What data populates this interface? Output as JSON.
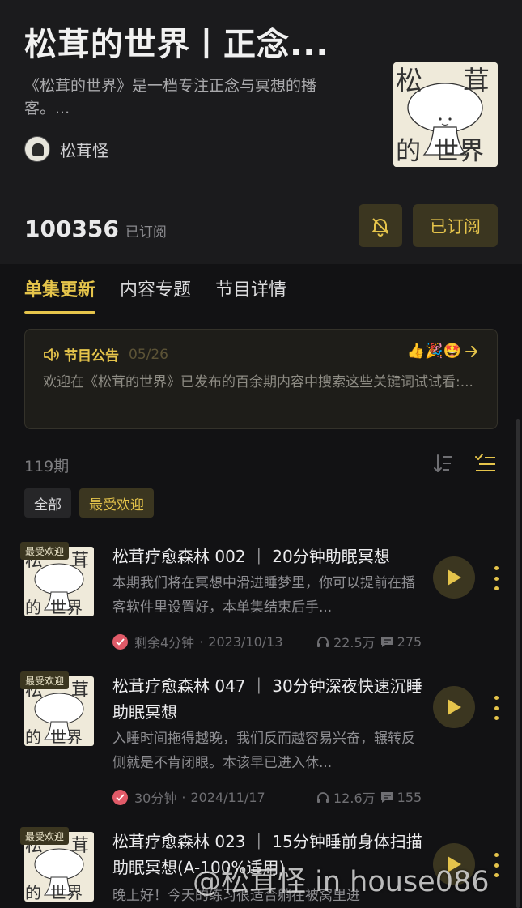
{
  "podcast": {
    "title": "松茸的世界丨正念...",
    "description": "《松茸的世界》是一档专注正念与冥想的播客。...",
    "author": "松茸怪",
    "cover_text": [
      "松",
      "茸",
      "的",
      "世界"
    ],
    "subscriber_count": "100356",
    "subscriber_label": "已订阅",
    "subscribe_button": "已订阅"
  },
  "tabs": [
    {
      "label": "单集更新",
      "active": true
    },
    {
      "label": "内容专题",
      "active": false
    },
    {
      "label": "节目详情",
      "active": false
    }
  ],
  "notice": {
    "title": "节目公告",
    "date": "05/26",
    "emojis": "👍🎉🤩",
    "text": "欢迎在《松茸的世界》已发布的百余期内容中搜索这些关键词试试看:..."
  },
  "episode_count": "119期",
  "filters": [
    "全部",
    "最受欢迎"
  ],
  "episodes": [
    {
      "badge": "最受欢迎",
      "title": "松茸疗愈森林 002 ｜ 20分钟助眠冥想",
      "summary": "本期我们将在冥想中滑进睡梦里，你可以提前在播客软件里设置好，本单集结束后手...",
      "progress": "剩余4分钟",
      "date": "2023/10/13",
      "plays": "22.5万",
      "comments": "275"
    },
    {
      "badge": "最受欢迎",
      "title": "松茸疗愈森林 047 ｜ 30分钟深夜快速沉睡助眠冥想",
      "summary": "入睡时间拖得越晚，我们反而越容易兴奋，辗转反侧就是不肯闭眼。本该早已进入休...",
      "progress": "30分钟",
      "date": "2024/11/17",
      "plays": "12.6万",
      "comments": "155"
    },
    {
      "badge": "最受欢迎",
      "title": "松茸疗愈森林 023 ｜ 15分钟睡前身体扫描助眠冥想(A-100%适用)",
      "summary": "晚上好！今天的练习很适合躺在被窝里进",
      "progress": "",
      "date": "",
      "plays": "",
      "comments": ""
    }
  ],
  "watermark": "@松茸怪 in house086",
  "colors": {
    "accent": "#e5c44b",
    "background": "#121214",
    "header": "#1b1b1d",
    "played": "#e05a68"
  }
}
